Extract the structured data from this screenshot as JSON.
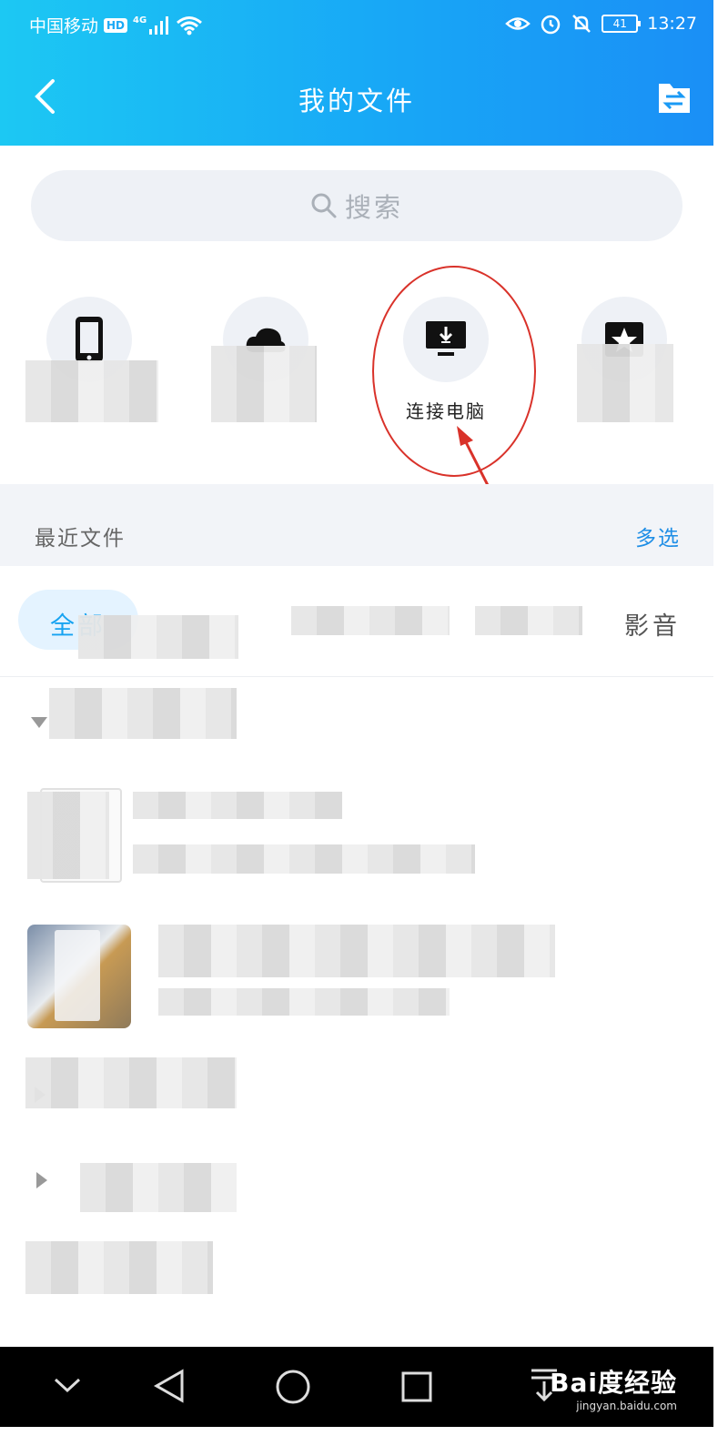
{
  "status_bar": {
    "carrier": "中国移动",
    "hd": "HD",
    "network": "4G",
    "battery": "41",
    "time": "13:27"
  },
  "header": {
    "title": "我的文件"
  },
  "search": {
    "placeholder": "搜索"
  },
  "quick_actions": [
    {
      "label": "",
      "icon": "phone-icon"
    },
    {
      "label": "",
      "icon": "cloud-icon"
    },
    {
      "label": "连接电脑",
      "icon": "monitor-download-icon"
    },
    {
      "label": "",
      "icon": "star-icon"
    }
  ],
  "recent": {
    "title": "最近文件",
    "multi_select": "多选"
  },
  "tabs": {
    "active": "全部",
    "last": "影音"
  },
  "watermark": {
    "brand": "Bai度经验",
    "url": "jingyan.baidu.com"
  },
  "colors": {
    "header_gradient_start": "#1cc8f3",
    "header_gradient_end": "#1a8ff6",
    "accent_blue": "#1f8ee6",
    "highlight_red": "#d9322a"
  }
}
